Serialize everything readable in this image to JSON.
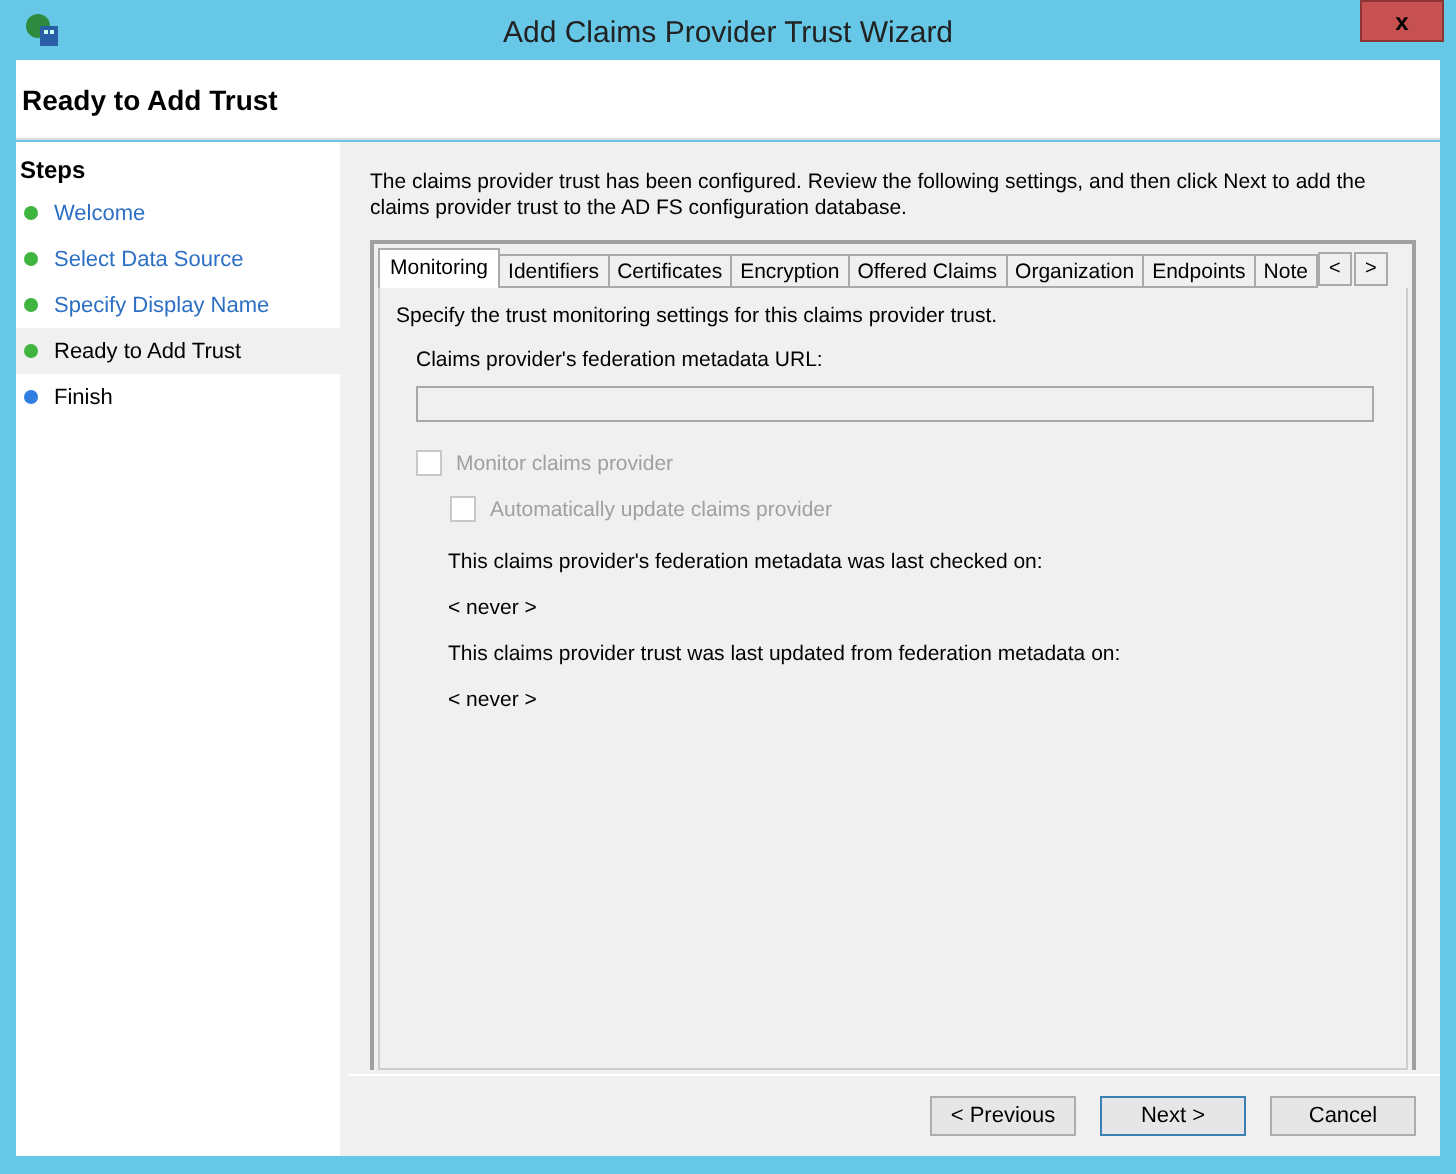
{
  "window": {
    "title": "Add Claims Provider Trust Wizard",
    "close": "x"
  },
  "header": {
    "title": "Ready to Add Trust"
  },
  "sidebar": {
    "title": "Steps",
    "items": [
      {
        "label": "Welcome",
        "selected": false,
        "color": "#3fb43f",
        "link": true
      },
      {
        "label": "Select Data Source",
        "selected": false,
        "color": "#3fb43f",
        "link": true
      },
      {
        "label": "Specify Display Name",
        "selected": false,
        "color": "#3fb43f",
        "link": true
      },
      {
        "label": "Ready to Add Trust",
        "selected": true,
        "color": "#3fb43f",
        "link": false
      },
      {
        "label": "Finish",
        "selected": false,
        "color": "#2f7fe0",
        "link": false
      }
    ]
  },
  "intro": "The claims provider trust has been configured. Review the following settings, and then click Next to add the claims provider trust to the AD FS configuration database.",
  "tabs": [
    {
      "label": "Monitoring",
      "selected": true
    },
    {
      "label": "Identifiers",
      "selected": false
    },
    {
      "label": "Certificates",
      "selected": false
    },
    {
      "label": "Encryption",
      "selected": false
    },
    {
      "label": "Offered Claims",
      "selected": false
    },
    {
      "label": "Organization",
      "selected": false
    },
    {
      "label": "Endpoints",
      "selected": false
    },
    {
      "label": "Note",
      "selected": false
    }
  ],
  "tab_scroll": [
    "<",
    ">"
  ],
  "panel": {
    "description": "Specify the trust monitoring settings for this claims provider trust.",
    "url_label": "Claims provider's federation metadata URL:",
    "url_field": {
      "disabled": true
    },
    "checkboxes": [
      {
        "label": "Monitor claims provider",
        "checked": false,
        "disabled": true,
        "children": [
          {
            "label": "Automatically update claims provider",
            "checked": false,
            "disabled": true
          }
        ]
      }
    ],
    "info": [
      {
        "label": "This claims provider's federation metadata was last checked on:",
        "value": "< never >"
      },
      {
        "label": "This claims provider trust was last updated from federation metadata on:",
        "value": "< never >"
      }
    ]
  },
  "buttons": [
    {
      "label": "< Previous",
      "default": false
    },
    {
      "label": "Next >",
      "default": true
    },
    {
      "label": "Cancel",
      "default": false
    }
  ]
}
